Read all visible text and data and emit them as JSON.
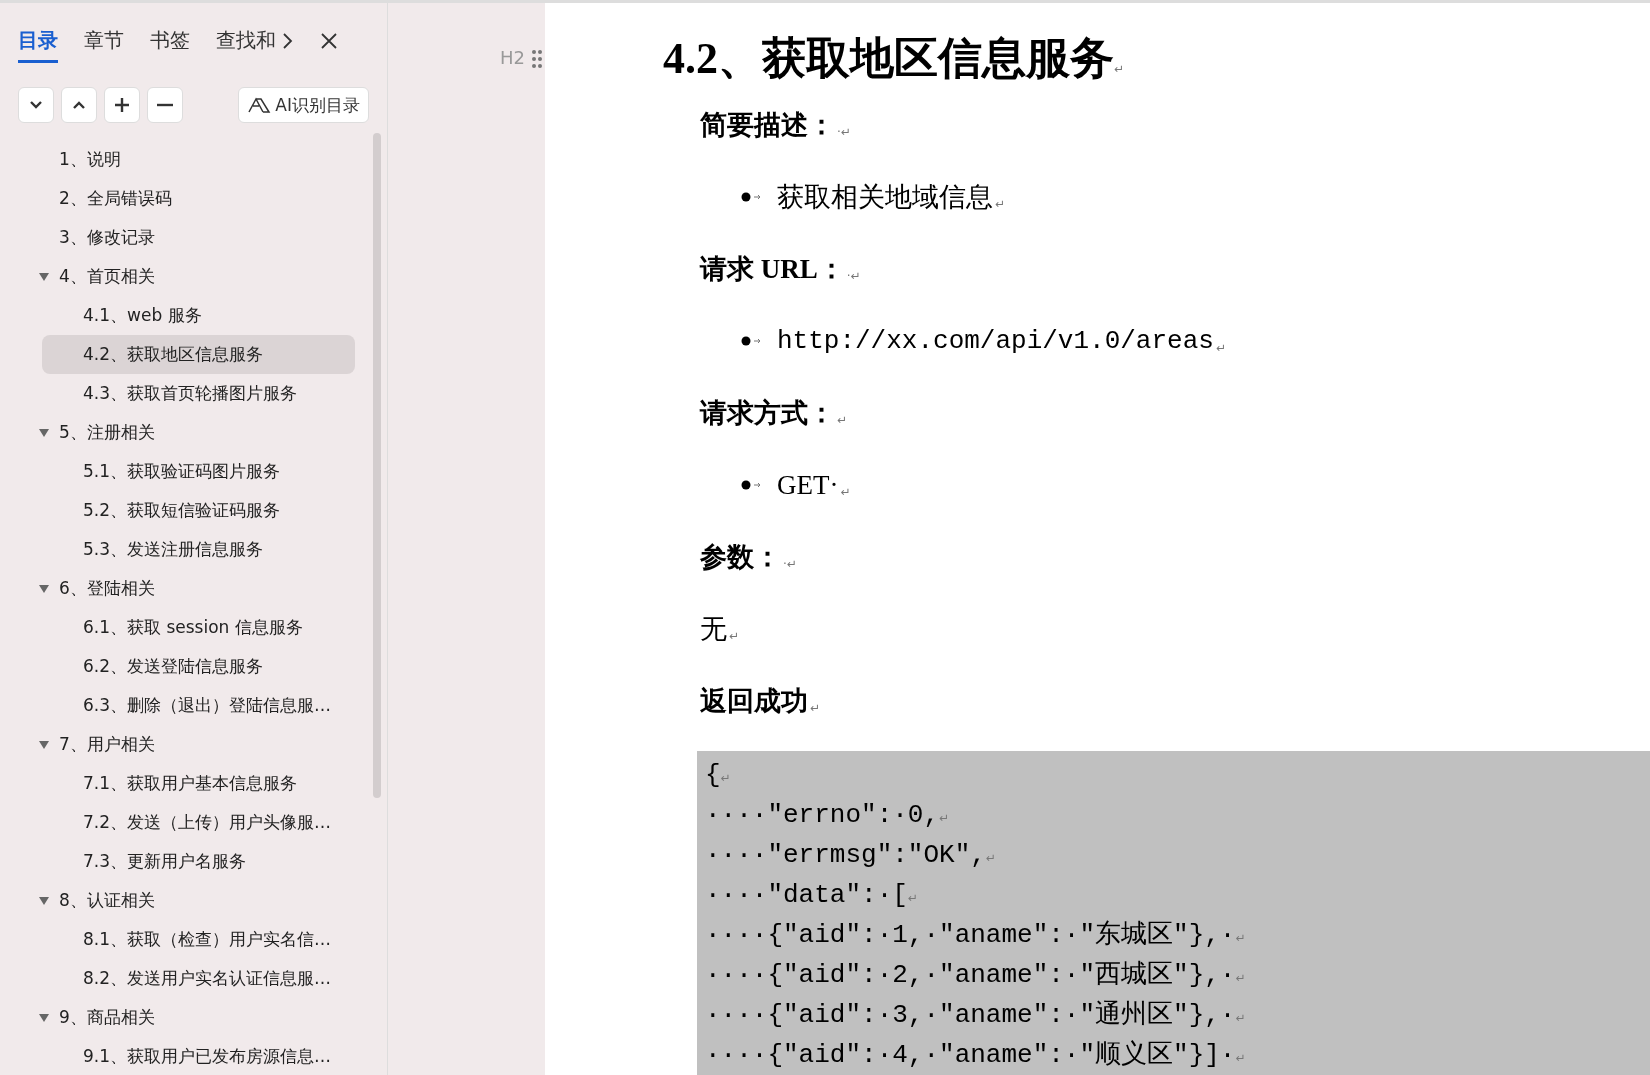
{
  "sidebar": {
    "tabs": [
      {
        "label": "目录",
        "selected": true
      },
      {
        "label": "章节",
        "selected": false
      },
      {
        "label": "书签",
        "selected": false
      },
      {
        "label": "查找和",
        "selected": false
      }
    ],
    "tools": [
      {
        "kind": "down"
      },
      {
        "kind": "up"
      },
      {
        "kind": "add"
      },
      {
        "kind": "remove"
      }
    ],
    "ai_button": "AI识别目录",
    "outline": [
      {
        "label": "1、说明",
        "selected": false
      },
      {
        "label": "2、全局错误码",
        "selected": false
      },
      {
        "label": "3、修改记录",
        "selected": false
      },
      {
        "label": "4、首页相关",
        "selected": false,
        "expanded": true,
        "children": [
          {
            "label": "4.1、web 服务",
            "selected": false
          },
          {
            "label": "4.2、获取地区信息服务",
            "selected": true
          },
          {
            "label": "4.3、获取首页轮播图片服务",
            "selected": false
          }
        ]
      },
      {
        "label": "5、注册相关",
        "selected": false,
        "expanded": true,
        "children": [
          {
            "label": "5.1、获取验证码图片服务",
            "selected": false
          },
          {
            "label": "5.2、获取短信验证码服务",
            "selected": false
          },
          {
            "label": "5.3、发送注册信息服务",
            "selected": false
          }
        ]
      },
      {
        "label": "6、登陆相关",
        "selected": false,
        "expanded": true,
        "children": [
          {
            "label": "6.1、获取 session 信息服务",
            "selected": false
          },
          {
            "label": "6.2、发送登陆信息服务",
            "selected": false
          },
          {
            "label": "6.3、删除（退出）登陆信息服…",
            "selected": false
          }
        ]
      },
      {
        "label": "7、用户相关",
        "selected": false,
        "expanded": true,
        "children": [
          {
            "label": "7.1、获取用户基本信息服务",
            "selected": false
          },
          {
            "label": "7.2、发送（上传）用户头像服…",
            "selected": false
          },
          {
            "label": "7.3、更新用户名服务",
            "selected": false
          }
        ]
      },
      {
        "label": "8、认证相关",
        "selected": false,
        "expanded": true,
        "children": [
          {
            "label": "8.1、获取（检查）用户实名信…",
            "selected": false
          },
          {
            "label": "8.2、发送用户实名认证信息服…",
            "selected": false
          }
        ]
      },
      {
        "label": "9、商品相关",
        "selected": false,
        "expanded": true,
        "children": [
          {
            "label": "9.1、获取用户已发布房源信息…",
            "selected": false
          }
        ]
      }
    ]
  },
  "document": {
    "level_tag": "H2",
    "title": "4.2、获取地区信息服务",
    "title_mark": "↵",
    "blocks": [
      {
        "kind": "label",
        "text": "简要描述：",
        "mark": "·↵"
      },
      {
        "kind": "bullet",
        "text": "获取相关地域信息",
        "mark": "↵"
      },
      {
        "kind": "label",
        "text": "请求 URL：",
        "mark": "·↵"
      },
      {
        "kind": "bullet",
        "text": "http://xx.com/api/v1.0/areas",
        "mark": "↵"
      },
      {
        "kind": "label",
        "text": "请求方式：",
        "mark": "↵"
      },
      {
        "kind": "bullet",
        "text": "GET·",
        "mark": "↵"
      },
      {
        "kind": "label",
        "text": "参数：",
        "mark": "·↵"
      },
      {
        "kind": "plain",
        "text": "无",
        "mark": "↵"
      },
      {
        "kind": "label",
        "text": "返回成功",
        "mark": "↵"
      }
    ],
    "code": [
      {
        "text": "{",
        "mark": "↵"
      },
      {
        "text": "····\"errno\":·0,",
        "mark": "↵"
      },
      {
        "text": "····\"errmsg\":\"OK\",",
        "mark": "↵"
      },
      {
        "text": "····\"data\":·[",
        "mark": "↵"
      },
      {
        "text": "····{\"aid\":·1,·\"aname\":·\"东城区\"},·",
        "mark": "↵"
      },
      {
        "text": "····{\"aid\":·2,·\"aname\":·\"西城区\"},·",
        "mark": "↵"
      },
      {
        "text": "····{\"aid\":·3,·\"aname\":·\"通州区\"},·",
        "mark": "↵"
      },
      {
        "text": "····{\"aid\":·4,·\"aname\":·\"顺义区\"}]·",
        "mark": "↵"
      }
    ]
  }
}
